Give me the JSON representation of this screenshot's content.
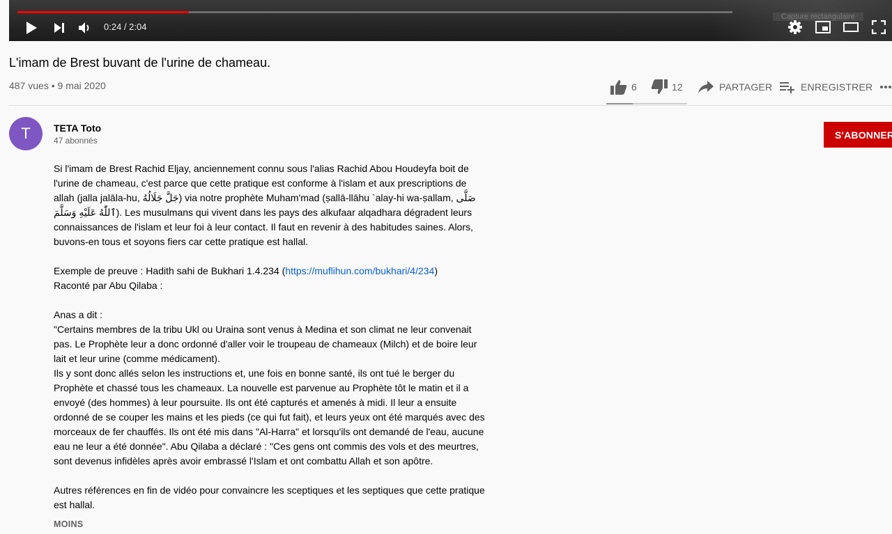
{
  "player": {
    "time": "0:24 / 2:04",
    "progress": 0.24,
    "overlay_text": "Capture rectangulaire"
  },
  "video": {
    "title": "L'imam de Brest buvant de l'urine de chameau.",
    "views": "487 vues",
    "separator": "•",
    "date": "9 mai 2020"
  },
  "actions": {
    "likes": "6",
    "dislikes": "12",
    "share_label": "PARTAGER",
    "save_label": "ENREGISTRER",
    "like_ratio": 0.33
  },
  "channel": {
    "avatar_letter": "T",
    "name": "TETA Toto",
    "subscribers": "47 abonnés",
    "subscribe_label": "S'ABONNER",
    "avatar_color": "#7e57c2",
    "subscribe_color": "#cc0000"
  },
  "description": {
    "p1": "Si l'imam de Brest Rachid Eljay, anciennement connu sous l'alias Rachid Abou Houdeyfa boit de l'urine de chameau, c'est parce que cette pratique est conforme à l'islam et aux prescriptions de allah (jalla jalāla-hu, جَلَّ جَلَالُهُ) via notre prophète Muham'mad (ṣallā-llāhu `alay-hi wa-ṣallam, صَلَّى ٱللّٰهُ عَلَيْهِ وَسَلَّمَ). Les musulmans qui vivent dans les pays des alkufaar alqadhara dégradent leurs connaissances de l'islam et leur foi à leur contact. Il faut en revenir à des habitudes saines. Alors, buvons-en tous et soyons fiers car cette pratique est hallal.",
    "proof_prefix": "Exemple de preuve : Hadith sahi de Bukhari 1.4.234 (",
    "proof_link": "https://muflihun.com/bukhari/4/234",
    "proof_suffix": ")",
    "narrated": "Raconté par Abu Qilaba :",
    "anas": "Anas a dit :",
    "hadith": "\"Certains membres de la tribu Ukl ou Uraina sont venus à Medina et son climat ne leur convenait pas. Le Prophète leur a donc ordonné d'aller voir le troupeau de chameaux (Milch) et de boire leur lait et leur urine (comme médicament).",
    "hadith2": "Ils y sont donc allés selon les instructions et, une fois en bonne santé, ils ont tué le berger du Prophète et chassé tous les chameaux. La nouvelle est parvenue au Prophète tôt le matin et il a envoyé (des hommes) à leur poursuite. Ils ont été capturés et amenés à midi. Il leur a ensuite ordonné de se couper les mains et les pieds (ce qui fut fait), et leurs yeux ont été marqués avec des morceaux de fer chauffés. Ils ont été mis dans \"Al-Harra\" et lorsqu'ils ont demandé de l'eau, aucune eau ne leur a été donnée\". Abu Qilaba a déclaré : \"Ces gens ont commis des vols et des meurtres, sont devenus infidèles après avoir embrassé l'Islam et ont combattu Allah et son apôtre.",
    "closing": "Autres références en fin de vidéo pour convaincre les sceptiques et les septiques que cette pratique est hallal.",
    "less_label": "MOINS"
  },
  "icons": {
    "play": "play-icon",
    "next": "next-icon",
    "volume": "volume-icon",
    "settings": "gear-icon",
    "miniplayer": "miniplayer-icon",
    "theater": "theater-icon",
    "fullscreen": "fullscreen-icon",
    "like": "thumb-up-icon",
    "dislike": "thumb-down-icon",
    "share": "share-arrow-icon",
    "save": "playlist-add-icon",
    "more": "more-horiz-icon"
  }
}
